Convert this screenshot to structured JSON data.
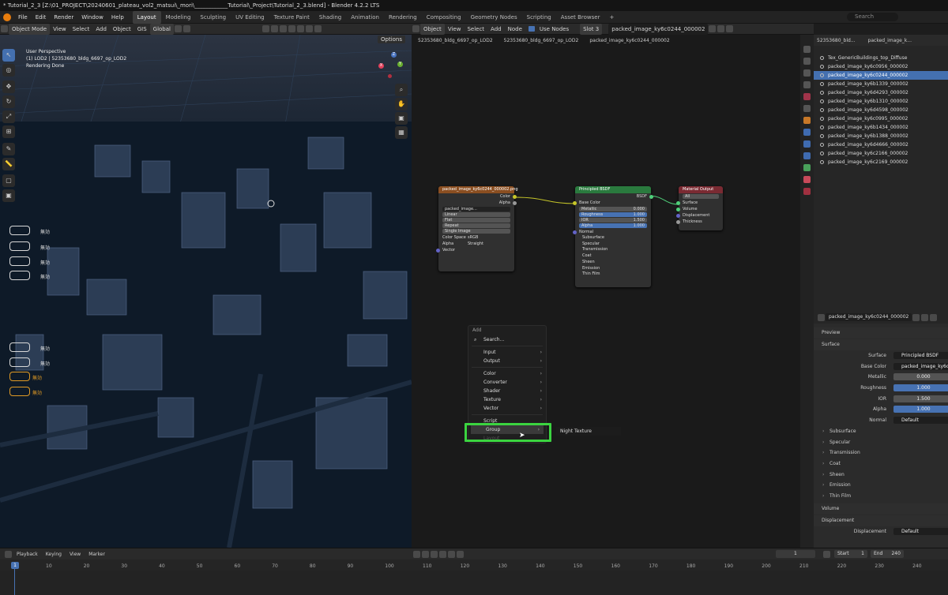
{
  "window_title": "* Tutorial_2_3 [Z:\\01_PROJECT\\20240601_plateau_vol2_matsui\\_mori\\____________Tutorial\\_Project\\Tutorial_2_3.blend] - Blender 4.2.2 LTS",
  "menu": [
    "File",
    "Edit",
    "Render",
    "Window",
    "Help"
  ],
  "workspaces": [
    "Layout",
    "Modeling",
    "Sculpting",
    "UV Editing",
    "Texture Paint",
    "Shading",
    "Animation",
    "Rendering",
    "Compositing",
    "Geometry Nodes",
    "Scripting",
    "Asset Browser",
    "+"
  ],
  "active_workspace": "Layout",
  "viewport": {
    "header": [
      "Object Mode",
      "View",
      "Select",
      "Add",
      "Object",
      "GIS",
      "Global"
    ],
    "options": "Options",
    "overlay": [
      "User Perspective",
      "(1) LOD2 | 52353680_bldg_6697_op_LOD2",
      "Rendering Done"
    ],
    "pill_label": "無効",
    "pills": [
      {
        "label": "無効",
        "orange": false
      },
      {
        "label": "無効",
        "orange": false
      },
      {
        "label": "無効",
        "orange": false
      },
      {
        "label": "無効",
        "orange": false
      },
      {
        "label": "無効",
        "orange": false
      },
      {
        "label": "無効",
        "orange": false
      },
      {
        "label": "無効",
        "orange": true
      },
      {
        "label": "無効",
        "orange": true
      }
    ],
    "gizmo": {
      "x": "X",
      "y": "Y",
      "z": "Z"
    }
  },
  "node_editor": {
    "header": [
      "Object",
      "View",
      "Select",
      "Add",
      "Node",
      "Use Nodes",
      "Slot 3",
      "packed_image_ky6c0244_000002"
    ],
    "breadcrumb": [
      "52353680_bldg_6697_op_LOD2",
      "52353680_bldg_6697_op_LOD2",
      "packed_image_ky6c0244_000002"
    ],
    "image_node": {
      "title": "packed_image_ky6c0244_000002.png",
      "outputs": [
        "Color",
        "Alpha"
      ],
      "image": "packed_image...",
      "interp": "Linear",
      "proj": "Flat",
      "ext": "Repeat",
      "source": "Single Image",
      "cs_label": "Color Space",
      "cs": "sRGB",
      "alpha_label": "Alpha",
      "alpha": "Straight",
      "input": "Vector"
    },
    "bsdf_node": {
      "title": "Principled BSDF",
      "out": "BSDF",
      "base": "Base Color",
      "fields": [
        {
          "l": "Metallic",
          "v": "0.000",
          "b": false
        },
        {
          "l": "Roughness",
          "v": "1.000",
          "b": true
        },
        {
          "l": "IOR",
          "v": "1.500",
          "b": false
        },
        {
          "l": "Alpha",
          "v": "1.000",
          "b": true
        }
      ],
      "normal": "Normal",
      "subs": [
        "Subsurface",
        "Specular",
        "Transmission",
        "Coat",
        "Sheen",
        "Emission",
        "Thin Film"
      ]
    },
    "output_node": {
      "title": "Material Output",
      "target": "All",
      "inputs": [
        "Surface",
        "Volume",
        "Displacement",
        "Thickness"
      ]
    },
    "add_menu": {
      "title": "Add",
      "search": "Search...",
      "items": [
        [
          "Input",
          "Output"
        ],
        [
          "Color",
          "Converter",
          "Shader",
          "Texture",
          "Vector"
        ],
        [
          "Script"
        ],
        [
          "Group"
        ],
        [
          "Layout"
        ]
      ],
      "highlight": "Group",
      "submenu": "Night Texture"
    }
  },
  "outliner": {
    "header": "52353680_bld...",
    "header2": "packed_image_k...",
    "search": "Search",
    "items": [
      "Tex_GenericBuildings_top_Diffuse",
      "packed_image_ky6c0956_000002",
      "packed_image_ky6c0244_000002",
      "packed_image_ky6b1339_000002",
      "packed_image_ky6d4293_000002",
      "packed_image_ky6b1310_000002",
      "packed_image_ky6d4598_000002",
      "packed_image_ky6c0995_000002",
      "packed_image_ky6b1434_000002",
      "packed_image_ky6b1388_000002",
      "packed_image_ky6d4666_000002",
      "packed_image_ky6c2166_000002",
      "packed_image_ky6c2169_000002"
    ],
    "selected_index": 2
  },
  "properties": {
    "material": "packed_image_ky6c0244_000002",
    "preview": "Preview",
    "surface_panel": "Surface",
    "surface_label": "Surface",
    "surface": "Principled BSDF",
    "base_label": "Base Color",
    "base": "packed_image_ky6c0...",
    "rows": [
      {
        "l": "Metallic",
        "v": "0.000",
        "b": false
      },
      {
        "l": "Roughness",
        "v": "1.000",
        "b": true
      },
      {
        "l": "IOR",
        "v": "1.500",
        "b": false
      },
      {
        "l": "Alpha",
        "v": "1.000",
        "b": true
      }
    ],
    "normal_label": "Normal",
    "normal": "Default",
    "sections": [
      "Subsurface",
      "Specular",
      "Transmission",
      "Coat",
      "Sheen",
      "Emission",
      "Thin Film"
    ],
    "volume": "Volume",
    "displacement_panel": "Displacement",
    "disp_label": "Displacement",
    "disp": "Default"
  },
  "timeline": {
    "menu": [
      "Playback",
      "Keying",
      "View",
      "Marker"
    ],
    "frame": "1",
    "current": "1",
    "start_label": "Start",
    "start": "1",
    "end_label": "End",
    "end": "240",
    "ticks": [
      "1",
      "10",
      "20",
      "30",
      "40",
      "50",
      "60",
      "70",
      "80",
      "90",
      "100",
      "110",
      "120",
      "130",
      "140",
      "150",
      "160",
      "170",
      "180",
      "190",
      "200",
      "210",
      "220",
      "230",
      "240"
    ]
  }
}
